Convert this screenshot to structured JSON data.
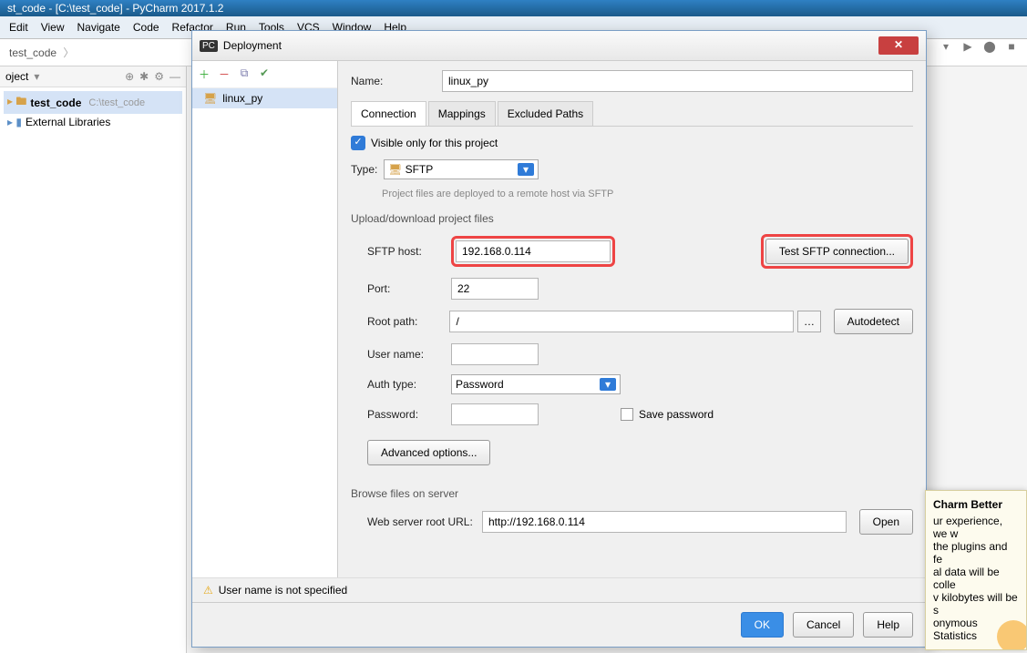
{
  "window": {
    "title": "st_code - [C:\\test_code] - PyCharm 2017.1.2"
  },
  "menu": [
    "Edit",
    "View",
    "Navigate",
    "Code",
    "Refactor",
    "Run",
    "Tools",
    "VCS",
    "Window",
    "Help"
  ],
  "breadcrumb": {
    "root": "test_code"
  },
  "project_panel": {
    "label": "oject",
    "items": [
      {
        "name": "test_code",
        "path": "C:\\test_code",
        "selected": true
      },
      {
        "name": "External Libraries"
      }
    ]
  },
  "dialog": {
    "title": "Deployment",
    "list_item": "linux_py",
    "name_label": "Name:",
    "name_value": "linux_py",
    "tabs": [
      "Connection",
      "Mappings",
      "Excluded Paths"
    ],
    "visible_only": "Visible only for this project",
    "type_label": "Type:",
    "type_value": "SFTP",
    "type_hint": "Project files are deployed to a remote host via SFTP",
    "upload_section": "Upload/download project files",
    "sftp_host_label": "SFTP host:",
    "sftp_host_value": "192.168.0.114",
    "test_btn": "Test SFTP connection...",
    "port_label": "Port:",
    "port_value": "22",
    "root_label": "Root path:",
    "root_value": "/",
    "autodetect": "Autodetect",
    "user_label": "User name:",
    "user_value": "",
    "auth_label": "Auth type:",
    "auth_value": "Password",
    "password_label": "Password:",
    "password_value": "",
    "save_pw": "Save password",
    "advanced": "Advanced options...",
    "browse_section": "Browse files on server",
    "web_label": "Web server root URL:",
    "web_value": "http://192.168.0.114",
    "open_btn": "Open",
    "warning": "User name is not specified",
    "ok": "OK",
    "cancel": "Cancel",
    "help": "Help"
  },
  "notif": {
    "title": "Charm Better",
    "lines": [
      "ur experience, we w",
      "the plugins and fe",
      "al data will be colle",
      "v kilobytes will be s",
      "onymous Statistics"
    ]
  }
}
